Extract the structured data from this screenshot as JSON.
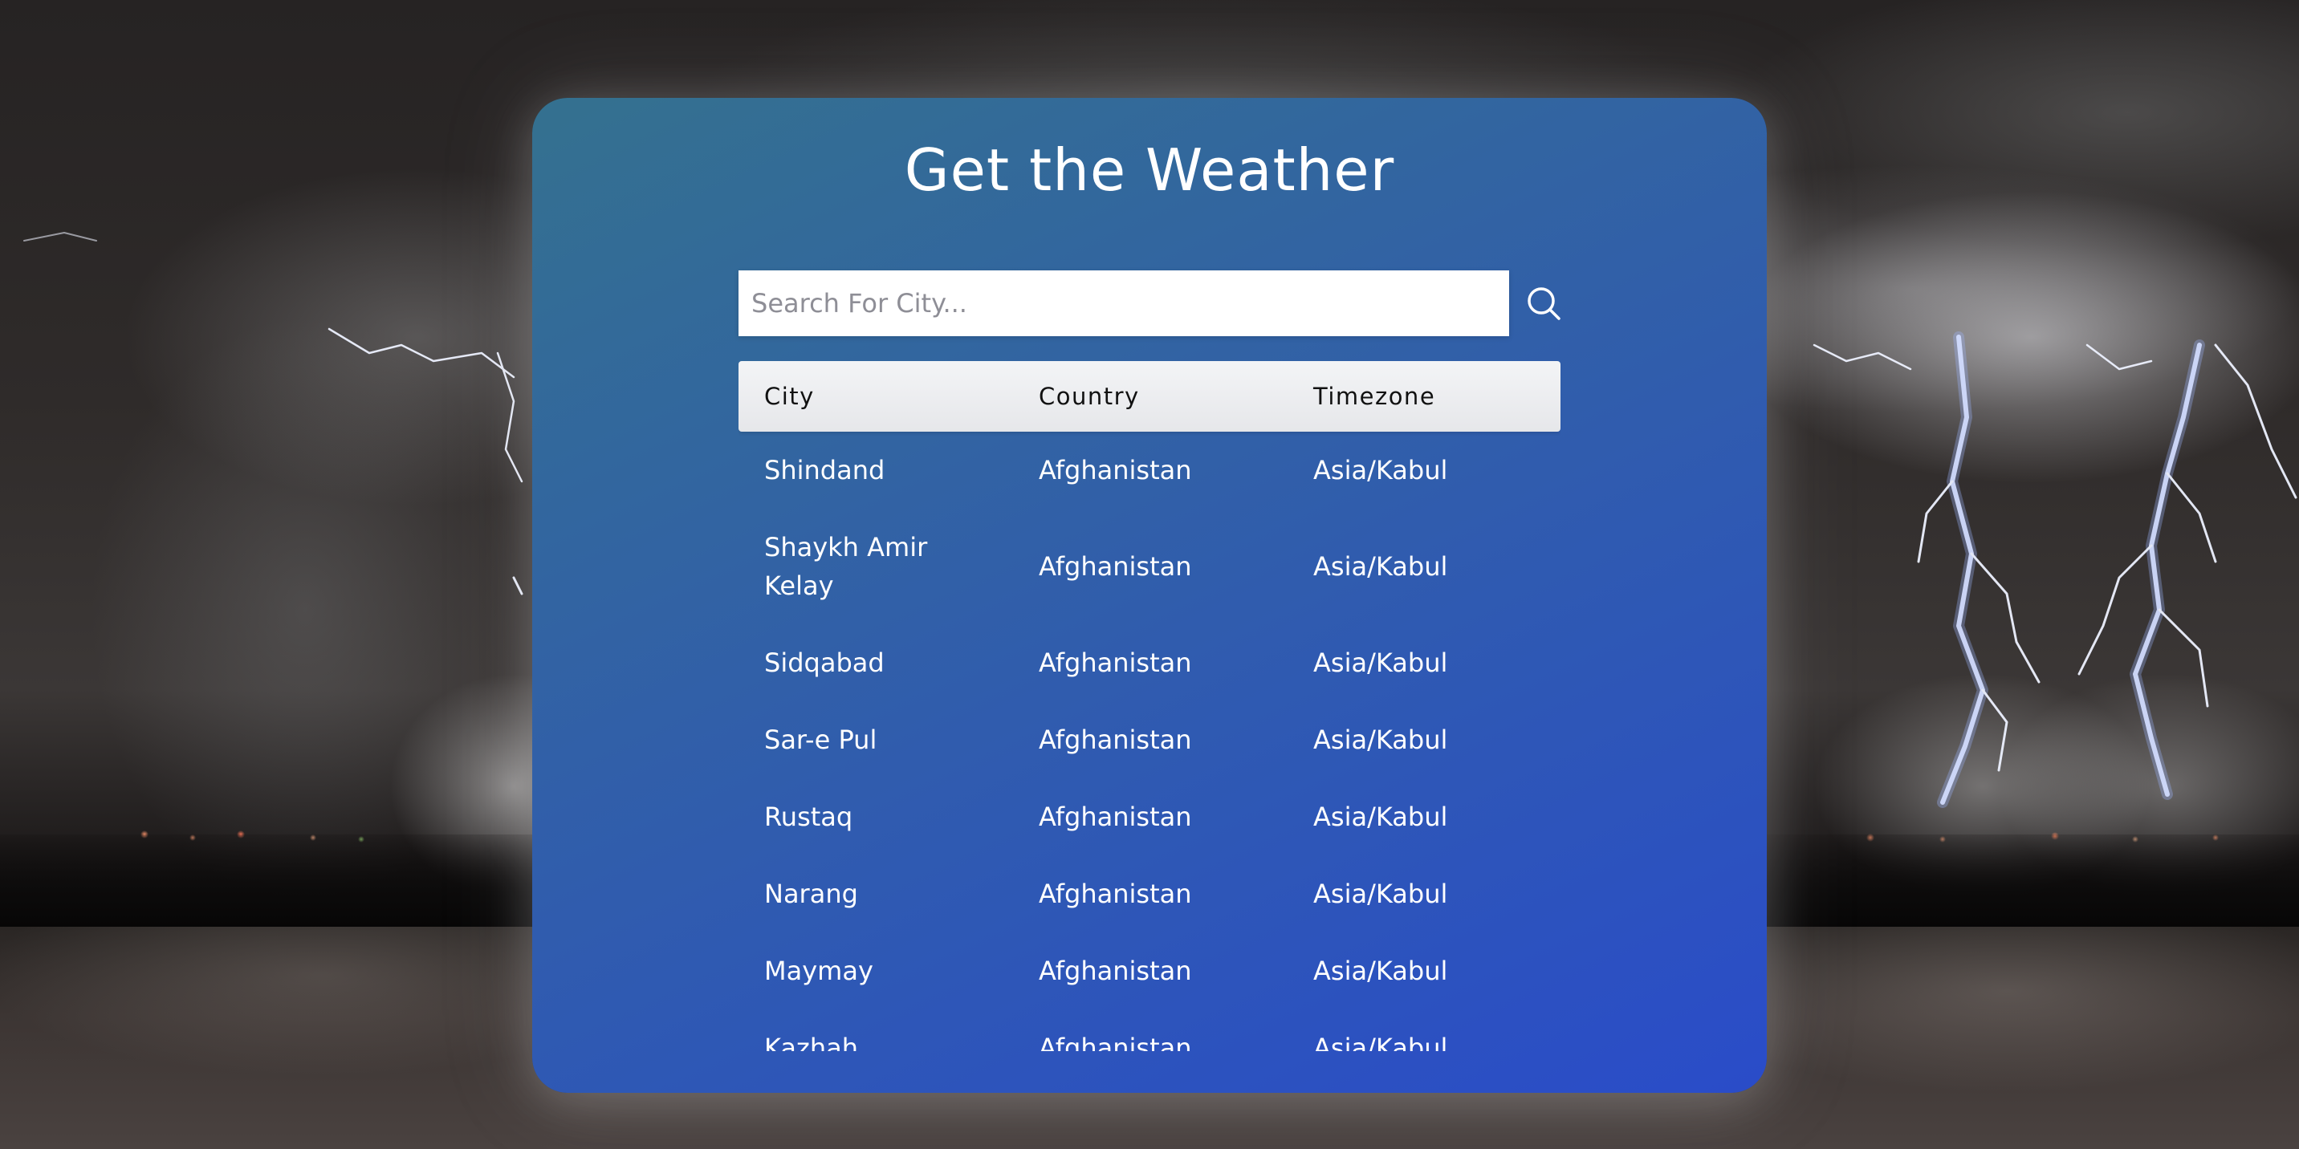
{
  "app": {
    "title": "Get the Weather"
  },
  "search": {
    "placeholder": "Search For City...",
    "value": "",
    "button_icon": "search-icon"
  },
  "table": {
    "headers": [
      "City",
      "Country",
      "Timezone"
    ],
    "rows": [
      {
        "city": "Shindand",
        "country": "Afghanistan",
        "timezone": "Asia/Kabul"
      },
      {
        "city": "Shaykh Amir Kelay",
        "country": "Afghanistan",
        "timezone": "Asia/Kabul"
      },
      {
        "city": "Sidqabad",
        "country": "Afghanistan",
        "timezone": "Asia/Kabul"
      },
      {
        "city": "Sar-e Pul",
        "country": "Afghanistan",
        "timezone": "Asia/Kabul"
      },
      {
        "city": "Rustaq",
        "country": "Afghanistan",
        "timezone": "Asia/Kabul"
      },
      {
        "city": "Narang",
        "country": "Afghanistan",
        "timezone": "Asia/Kabul"
      },
      {
        "city": "Maymay",
        "country": "Afghanistan",
        "timezone": "Asia/Kabul"
      },
      {
        "city": "Kazhah",
        "country": "Afghanistan",
        "timezone": "Asia/Kabul"
      }
    ]
  },
  "colors": {
    "card_start": "#34718f",
    "card_end": "#2a4cc9",
    "header_bg": "#f3f4f6",
    "text": "#ffffff"
  }
}
